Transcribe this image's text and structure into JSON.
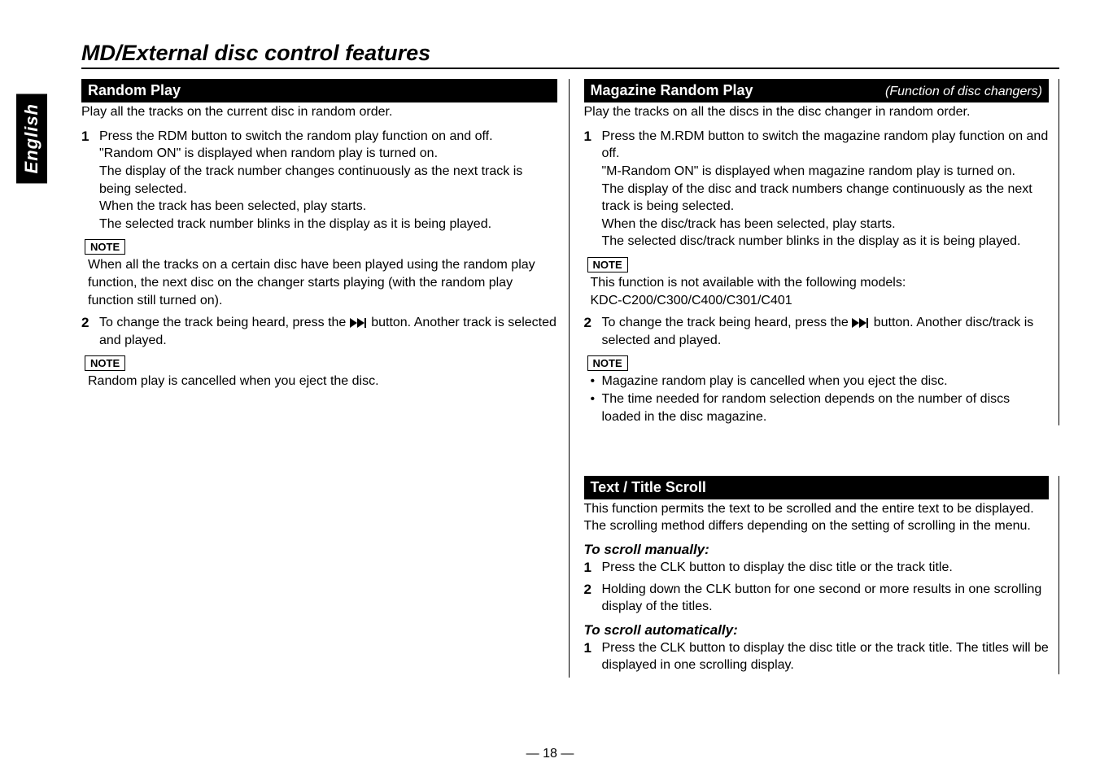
{
  "language": "English",
  "page_title": "MD/External disc control features",
  "page_number": "— 18 —",
  "left": {
    "header": "Random Play",
    "intro": "Play all the tracks on the current disc in random order.",
    "step1_n": "1",
    "step1": "Press the RDM button to switch the random play function on and off.\n\"Random ON\" is displayed when random play is turned on.\nThe display of the track number changes continuously as the next track is being selected.\nWhen the track has been selected, play starts.\nThe selected track number blinks in the display as it is being played.",
    "note1_label": "NOTE",
    "note1": "When all the tracks on a certain disc have been played using the random play function, the next disc on the changer starts playing (with the random play function still turned on).",
    "step2_n": "2",
    "step2_a": "To change the track being heard, press the ",
    "step2_b": " button. Another track is selected and played.",
    "note2_label": "NOTE",
    "note2": "Random play is cancelled when you eject the disc."
  },
  "right_top": {
    "header": "Magazine Random Play",
    "subtitle": "(Function of disc changers)",
    "intro": "Play the tracks on all the discs in the disc changer in random order.",
    "step1_n": "1",
    "step1": "Press the M.RDM button to switch the magazine random play function on and off.\n\"M-Random ON\" is displayed when magazine random play is turned on.\nThe display of the disc and track numbers change continuously as the next track is being selected.\nWhen the disc/track has been selected, play starts.\nThe selected disc/track number blinks in the display as it is being played.",
    "note1_label": "NOTE",
    "note1": "This function is not available with the following models:\nKDC-C200/C300/C400/C301/C401",
    "step2_n": "2",
    "step2_a": "To change the track being heard, press the ",
    "step2_b": " button. Another disc/track is selected and played.",
    "note2_label": "NOTE",
    "bullet1": "Magazine random play is cancelled when you eject the disc.",
    "bullet2": "The time needed for random selection depends on the number of discs loaded in the disc magazine."
  },
  "right_bottom": {
    "header": "Text / Title Scroll",
    "intro": "This function permits the text to be scrolled and the entire text to be displayed. The scrolling method differs depending on the setting of scrolling in the menu.",
    "sub1": "To scroll manually:",
    "s1_n": "1",
    "s1": "Press the CLK button to display the disc title or the track title.",
    "s2_n": "2",
    "s2": "Holding down the CLK button for one second or more results in one scrolling display of the titles.",
    "sub2": "To scroll automatically:",
    "a1_n": "1",
    "a1": "Press the CLK button to display the disc title or the track title. The titles will be displayed in one scrolling display."
  }
}
